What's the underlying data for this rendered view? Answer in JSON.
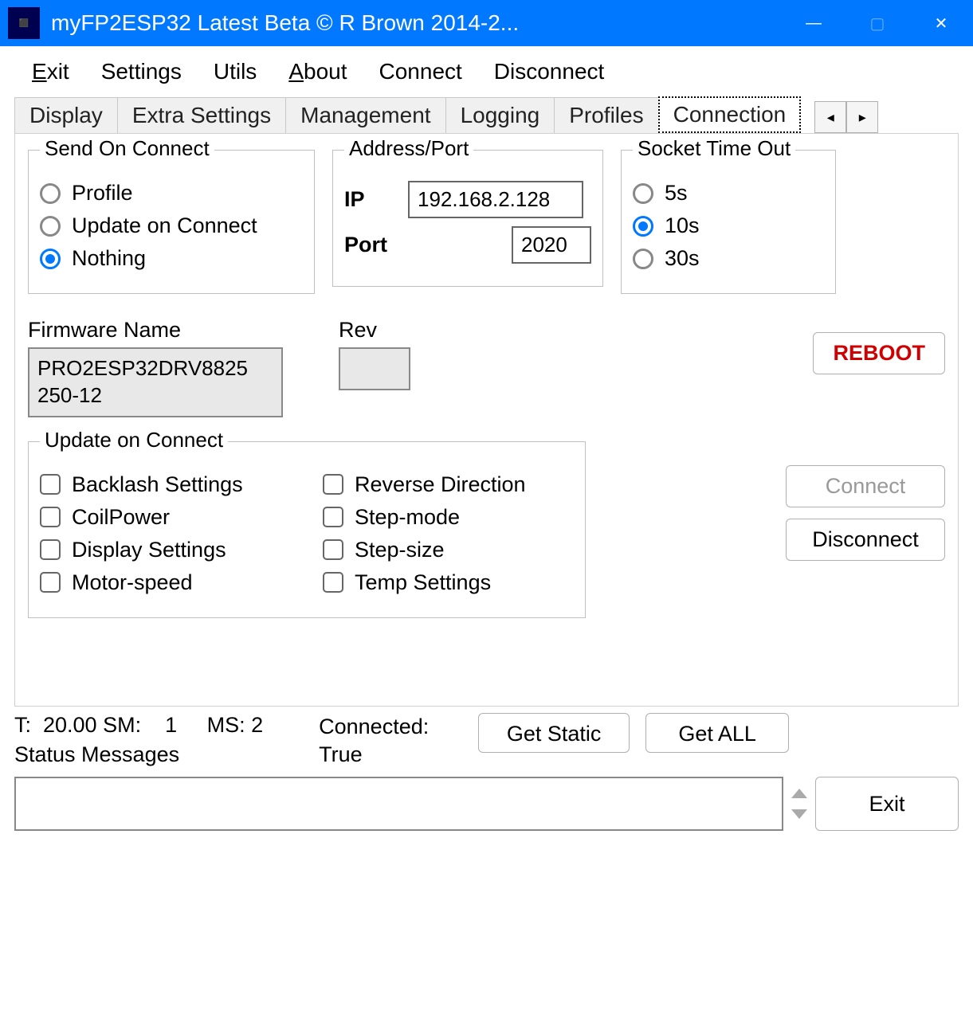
{
  "window": {
    "title": "myFP2ESP32 Latest Beta © R Brown 2014-2..."
  },
  "menu": {
    "exit": "Exit",
    "settings": "Settings",
    "utils": "Utils",
    "about": "About",
    "connect": "Connect",
    "disconnect": "Disconnect"
  },
  "tabs": {
    "display": "Display",
    "extra": "Extra Settings",
    "management": "Management",
    "logging": "Logging",
    "profiles": "Profiles",
    "connection": "Connection"
  },
  "sendOnConnect": {
    "legend": "Send On Connect",
    "profile": "Profile",
    "update": "Update on Connect",
    "nothing": "Nothing",
    "selected": "nothing"
  },
  "address": {
    "legend": "Address/Port",
    "ipLabel": "IP",
    "ipValue": "192.168.2.128",
    "portLabel": "Port",
    "portValue": "2020"
  },
  "timeout": {
    "legend": "Socket Time Out",
    "t5": "5s",
    "t10": "10s",
    "t30": "30s",
    "selected": "10s"
  },
  "firmware": {
    "nameLabel": "Firmware Name",
    "nameValue": "PRO2ESP32DRV8825250-12",
    "revLabel": "Rev",
    "revValue": ""
  },
  "buttons": {
    "reboot": "REBOOT",
    "connect": "Connect",
    "disconnect": "Disconnect",
    "getStatic": "Get Static",
    "getAll": "Get ALL",
    "exit": "Exit"
  },
  "updateOnConnect": {
    "legend": "Update on Connect",
    "backlash": "Backlash Settings",
    "coil": "CoilPower",
    "display": "Display Settings",
    "motor": "Motor-speed",
    "reverse": "Reverse Direction",
    "stepmode": "Step-mode",
    "stepsize": "Step-size",
    "temp": "Temp Settings"
  },
  "status": {
    "line": "T:  20.00 SM:    1     MS: 2",
    "connected": "Connected: True",
    "msgLabel": "Status Messages"
  }
}
